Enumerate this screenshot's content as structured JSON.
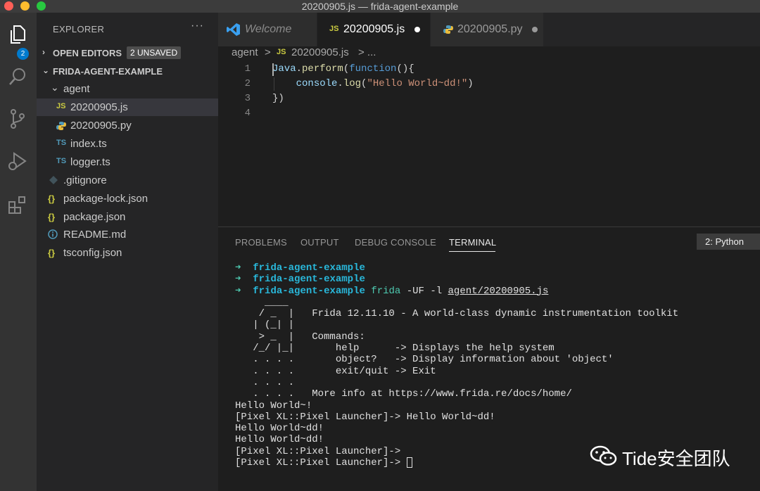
{
  "window": {
    "title": "20200905.js — frida-agent-example"
  },
  "activity": {
    "badge": "2"
  },
  "sidebar": {
    "header": "EXPLORER",
    "more": "···",
    "open_editors": {
      "label": "OPEN EDITORS",
      "badge": "2 UNSAVED"
    },
    "project": {
      "label": "FRIDA-AGENT-EXAMPLE"
    },
    "items": [
      {
        "label": "agent",
        "icon": "folder-chevron"
      },
      {
        "label": "20200905.js",
        "icon": "JS"
      },
      {
        "label": "20200905.py",
        "icon": "python-icon"
      },
      {
        "label": "index.ts",
        "icon": "TS"
      },
      {
        "label": "logger.ts",
        "icon": "TS"
      },
      {
        "label": ".gitignore",
        "icon": "git-icon"
      },
      {
        "label": "package-lock.json",
        "icon": "{}"
      },
      {
        "label": "package.json",
        "icon": "{}"
      },
      {
        "label": "README.md",
        "icon": "info-icon"
      },
      {
        "label": "tsconfig.json",
        "icon": "{}"
      }
    ]
  },
  "tabs": [
    {
      "label": "Welcome"
    },
    {
      "label": "20200905.js",
      "icon": "JS"
    },
    {
      "label": "20200905.py"
    }
  ],
  "breadcrumb": {
    "folder": "agent",
    "sep": ">",
    "icon": "JS",
    "file": "20200905.js",
    "tail": "> ..."
  },
  "editor": {
    "line_numbers": [
      "1",
      "2",
      "3",
      "4"
    ],
    "lines": {
      "l1_obj": "Java",
      "l1_dot": ".",
      "l1_fn": "perform",
      "l1_open": "(",
      "l1_kw": "function",
      "l1_rest": "(){",
      "l2_indent": "    ",
      "l2_obj": "console",
      "l2_dot": ".",
      "l2_fn": "log",
      "l2_open": "(",
      "l2_str": "\"Hello World~dd!\"",
      "l2_close": ")",
      "l3": "})"
    }
  },
  "panel": {
    "tabs": [
      "PROBLEMS",
      "OUTPUT",
      "DEBUG CONSOLE",
      "TERMINAL"
    ],
    "terminal_select": "2: Python"
  },
  "terminal": {
    "arrow": "➜",
    "prompt1": "frida-agent-example",
    "prompt2": "frida-agent-example",
    "prompt3": "frida-agent-example",
    "cmd": "frida",
    "cmd_args": " -UF -l ",
    "cmd_path": "agent/20200905.js",
    "banner": [
      "     ____",
      "    / _  |   Frida 12.11.10 - A world-class dynamic instrumentation toolkit",
      "   | (_| |",
      "    > _  |   Commands:",
      "   /_/ |_|       help      -> Displays the help system",
      "   . . . .       object?   -> Display information about 'object'",
      "   . . . .       exit/quit -> Exit",
      "   . . . .",
      "   . . . .   More info at https://www.frida.re/docs/home/"
    ],
    "output": [
      "Hello World~!",
      "[Pixel XL::Pixel Launcher]-> Hello World~dd!",
      "Hello World~dd!",
      "Hello World~dd!",
      "[Pixel XL::Pixel Launcher]->"
    ],
    "last_prompt": "[Pixel XL::Pixel Launcher]-> "
  },
  "watermark": {
    "text": "Tide安全团队"
  },
  "colors": {
    "accent": "#007acc",
    "sidebar": "#252526",
    "editor": "#1e1e1e",
    "activity": "#333333"
  }
}
